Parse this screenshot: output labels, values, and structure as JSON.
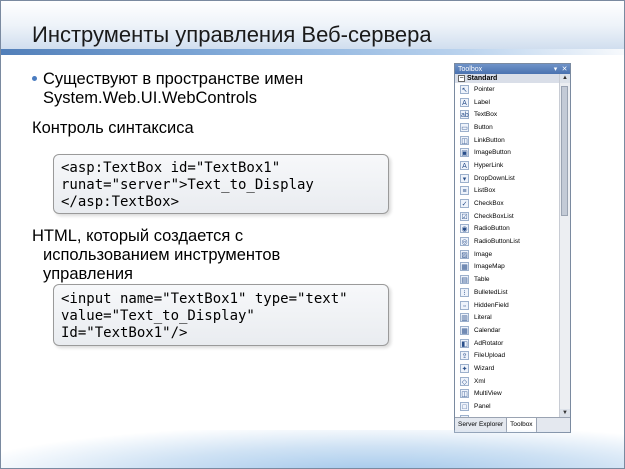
{
  "slide": {
    "title": "Инструменты управления Веб-сервера",
    "bullet": "Существуют в пространстве имен System.Web.UI.WebControls",
    "syntax_heading": "Контроль синтаксиса",
    "code1": [
      "<asp:TextBox id=\"TextBox1\"",
      "runat=\"server\">Text_to_Display",
      "</asp:TextBox>"
    ],
    "html_heading_line1": "HTML, который создается с",
    "html_heading_line2": "использованием инструментов",
    "html_heading_line3": "управления",
    "code2": [
      "<input name=\"TextBox1\" type=\"text\"",
      "value=\"Text_to_Display\"",
      "Id=\"TextBox1\"/>"
    ]
  },
  "toolbox": {
    "title": "Toolbox",
    "controls": [
      "▾",
      "✕"
    ],
    "category": "Standard",
    "items": [
      {
        "label": "Pointer",
        "icon": "↖"
      },
      {
        "label": "Label",
        "icon": "A"
      },
      {
        "label": "TextBox",
        "icon": "ab"
      },
      {
        "label": "Button",
        "icon": "▭"
      },
      {
        "label": "LinkButton",
        "icon": "◫"
      },
      {
        "label": "ImageButton",
        "icon": "▣"
      },
      {
        "label": "HyperLink",
        "icon": "A"
      },
      {
        "label": "DropDownList",
        "icon": "▾"
      },
      {
        "label": "ListBox",
        "icon": "≡"
      },
      {
        "label": "CheckBox",
        "icon": "✓"
      },
      {
        "label": "CheckBoxList",
        "icon": "☑"
      },
      {
        "label": "RadioButton",
        "icon": "◉"
      },
      {
        "label": "RadioButtonList",
        "icon": "◎"
      },
      {
        "label": "Image",
        "icon": "▨"
      },
      {
        "label": "ImageMap",
        "icon": "▦"
      },
      {
        "label": "Table",
        "icon": "▤"
      },
      {
        "label": "BulletedList",
        "icon": "⁝"
      },
      {
        "label": "HiddenField",
        "icon": "▫"
      },
      {
        "label": "Literal",
        "icon": "▥"
      },
      {
        "label": "Calendar",
        "icon": "▦"
      },
      {
        "label": "AdRotator",
        "icon": "◧"
      },
      {
        "label": "FileUpload",
        "icon": "⇪"
      },
      {
        "label": "Wizard",
        "icon": "✦"
      },
      {
        "label": "Xml",
        "icon": "◇"
      },
      {
        "label": "MultiView",
        "icon": "◫"
      },
      {
        "label": "Panel",
        "icon": "□"
      },
      {
        "label": "",
        "icon": "▯"
      }
    ],
    "tabs": [
      "Server Explorer",
      "Toolbox"
    ]
  }
}
